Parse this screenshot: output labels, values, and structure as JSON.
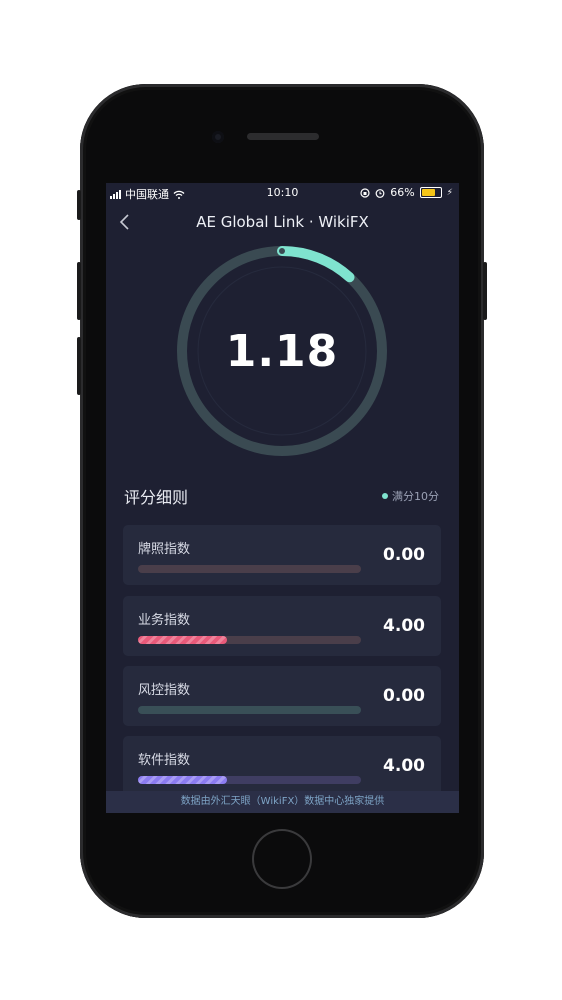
{
  "status_bar": {
    "carrier": "中国联通",
    "time": "10:10",
    "battery_percent": "66%",
    "battery_level": 0.66
  },
  "nav": {
    "back_icon": "chevron-left-icon",
    "title": "AE Global Link · WikiFX"
  },
  "score": {
    "value": "1.18",
    "max": 10,
    "progress_fraction": 0.118
  },
  "section": {
    "title": "评分细则",
    "full_mark": "满分10分"
  },
  "items": [
    {
      "label": "牌照指数",
      "value": "0.00",
      "fraction": 0.0,
      "color": "#e85a7a"
    },
    {
      "label": "业务指数",
      "value": "4.00",
      "fraction": 0.4,
      "color": "#e85a7a"
    },
    {
      "label": "风控指数",
      "value": "0.00",
      "fraction": 0.0,
      "color": "#5bb0a8"
    },
    {
      "label": "软件指数",
      "value": "4.00",
      "fraction": 0.4,
      "color": "#8c7cf0"
    }
  ],
  "footer": {
    "text": "数据由外汇天眼（WikiFX）数据中心独家提供"
  },
  "colors": {
    "accent": "#7fe3cf",
    "background": "#1e2032",
    "card": "#262a3d"
  }
}
